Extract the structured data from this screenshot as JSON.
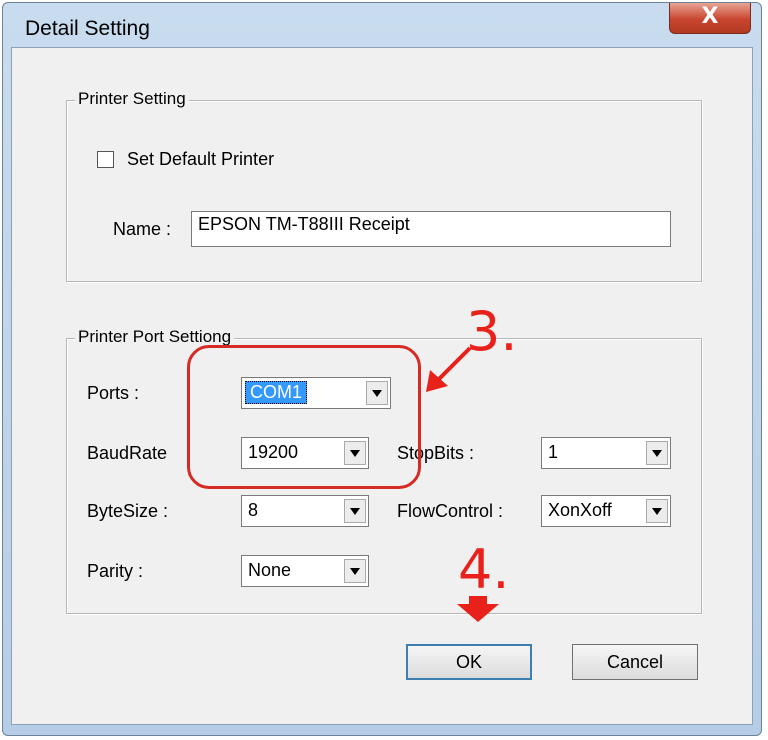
{
  "window": {
    "title": "Detail Setting",
    "close_glyph": "X"
  },
  "printer_setting": {
    "group_label": "Printer Setting",
    "default_checkbox_label": "Set Default Printer",
    "default_checked": false,
    "name_label": "Name :",
    "name_value": "EPSON TM-T88III Receipt"
  },
  "port_setting": {
    "group_label": "Printer Port Settiong",
    "ports_label": "Ports :",
    "ports_value": "COM1",
    "baud_label": "BaudRate",
    "baud_value": "19200",
    "stopbits_label": "StopBits :",
    "stopbits_value": "1",
    "bytesize_label": "ByteSize :",
    "bytesize_value": "8",
    "flow_label": "FlowControl :",
    "flow_value": "XonXoff",
    "parity_label": "Parity :",
    "parity_value": "None"
  },
  "buttons": {
    "ok": "OK",
    "cancel": "Cancel"
  },
  "annotations": {
    "step3": "3.",
    "step4": "4.",
    "color": "#e8211b"
  }
}
